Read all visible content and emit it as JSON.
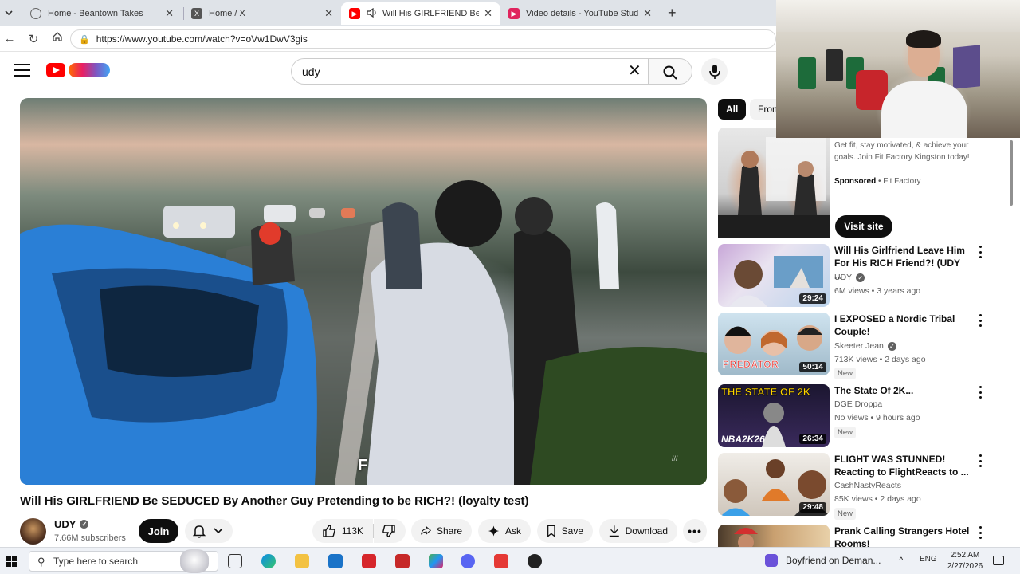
{
  "browser": {
    "tabs": [
      {
        "title": "Home - Beantown Takes",
        "active": false
      },
      {
        "title": "Home / X",
        "active": false
      },
      {
        "title": "Will His GIRLFRIEND Be SEDUC",
        "active": true
      },
      {
        "title": "Video details - YouTube Studio",
        "active": false
      }
    ],
    "url": "https://www.youtube.com/watch?v=oVw1DwV3gis"
  },
  "youtube": {
    "search_value": "udy"
  },
  "video": {
    "caption_glyph": "F",
    "title": "Will His GIRLFRIEND Be SEDUCED By Another Guy Pretending to be RICH?! (loyalty test)",
    "channel": "UDY",
    "subscribers": "7.66M subscribers",
    "join_label": "Join",
    "likes": "113K",
    "share_label": "Share",
    "ask_label": "Ask",
    "save_label": "Save",
    "download_label": "Download"
  },
  "chips": [
    "All",
    "Fron"
  ],
  "ad": {
    "description": "Get fit, stay motivated, & achieve your goals. Join Fit Factory Kingston today!",
    "sponsored_label": "Sponsored",
    "advertiser": "Fit Factory",
    "cta": "Visit site"
  },
  "recommendations": [
    {
      "title": "Will His Girlfriend Leave Him For His RICH Friend?! (UDY ...",
      "channel": "UDY",
      "verified": true,
      "meta": "6M views • 3 years ago",
      "duration": "29:24",
      "new": false
    },
    {
      "title": "I EXPOSED a Nordic Tribal Couple!",
      "channel": "Skeeter Jean",
      "verified": true,
      "meta": "713K views • 2 days ago",
      "duration": "50:14",
      "new": true,
      "thumb_text": "PREDATOR"
    },
    {
      "title": "The State Of 2K...",
      "channel": "DGE Droppa",
      "verified": false,
      "meta": "No views • 9 hours ago",
      "duration": "26:34",
      "new": true,
      "thumb_text": "THE STATE OF 2K",
      "thumb_text2": "NBA2K26"
    },
    {
      "title": "FLIGHT WAS STUNNED! Reacting to FlightReacts to ...",
      "channel": "CashNastyReacts",
      "verified": false,
      "meta": "85K views • 2 days ago",
      "duration": "29:48",
      "new": true
    },
    {
      "title": "Prank Calling Strangers Hotel Rooms!",
      "channel": "",
      "verified": false,
      "meta": "",
      "duration": "",
      "new": false
    }
  ],
  "new_label": "New",
  "taskbar": {
    "search_placeholder": "Type here to search",
    "media_title": "Boyfriend on Deman...",
    "language": "ENG",
    "time": "2:52 AM",
    "date": "2/27/2026"
  },
  "colors": {
    "youtube_red": "#ff0000",
    "tab_strip": "#dfe3e8",
    "button_dark": "#0f0f0f",
    "button_light": "#f2f2f2"
  }
}
